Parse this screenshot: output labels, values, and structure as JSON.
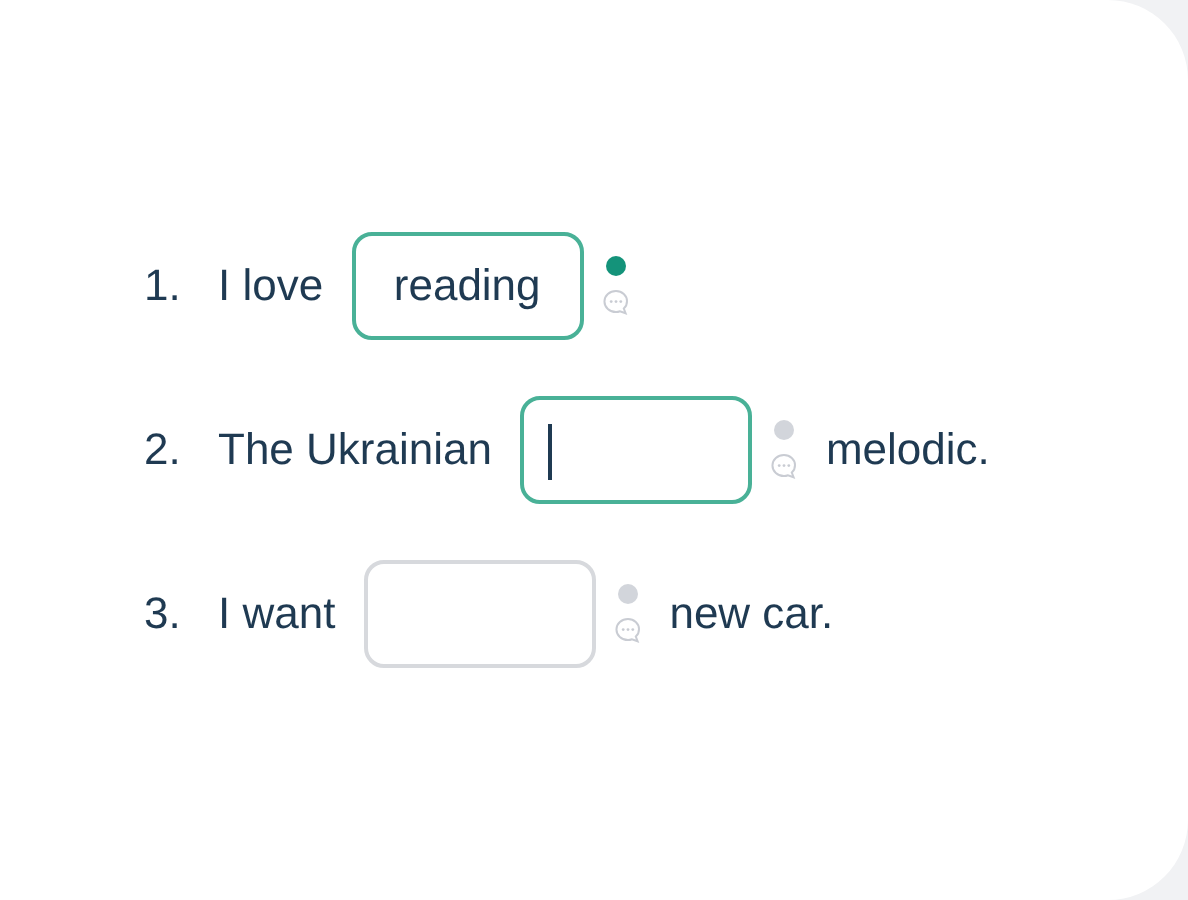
{
  "items": [
    {
      "number": "1.",
      "before": "I love",
      "answer": "reading",
      "answered": true,
      "focused": false
    },
    {
      "number": "2.",
      "before": "The Ukrainian",
      "after": "melodic.",
      "answered": false,
      "focused": true
    },
    {
      "number": "3.",
      "before": "I want",
      "after": "new car.",
      "answered": false,
      "focused": false
    }
  ]
}
